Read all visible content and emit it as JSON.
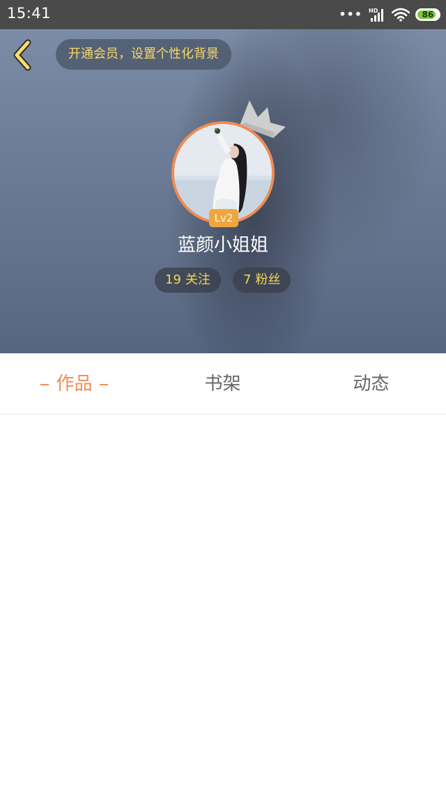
{
  "status_bar": {
    "time": "15:41",
    "dots": "•••",
    "network_label": "HD",
    "battery": "86",
    "battery_level": 0.86
  },
  "header": {
    "vip_banner": "开通会员，设置个性化背景",
    "level": "Lv2",
    "username": "蓝颜小姐姐",
    "following_count": "19",
    "following_label": "关注",
    "fans_count": "7",
    "fans_label": "粉丝"
  },
  "tabs": [
    {
      "label": "作品",
      "active": true
    },
    {
      "label": "书架",
      "active": false
    },
    {
      "label": "动态",
      "active": false
    }
  ],
  "colors": {
    "accent": "#f08c52",
    "gold_text": "#f5d650",
    "status_bar_bg": "#4a4a4a",
    "battery_green": "#7ec83b"
  },
  "icons": [
    "back-arrow-icon",
    "crown-icon",
    "signal-icon",
    "wifi-icon",
    "battery-icon"
  ]
}
